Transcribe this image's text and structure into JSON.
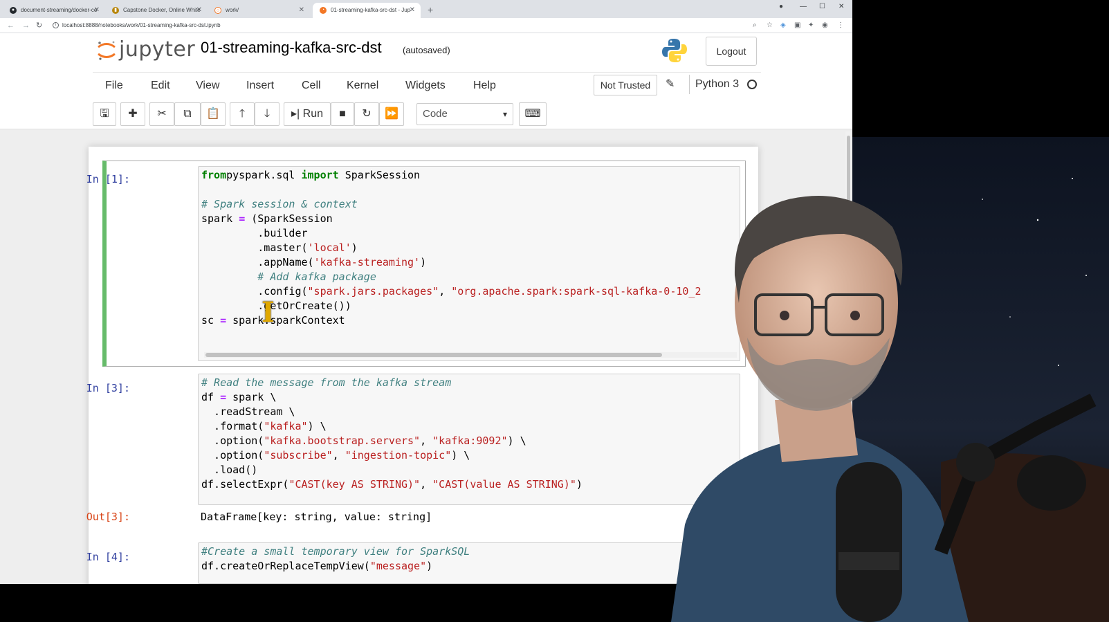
{
  "browser": {
    "tabs": [
      {
        "title": "document-streaming/docker-co",
        "active": false
      },
      {
        "title": "Capstone Docker, Online White",
        "active": false
      },
      {
        "title": "work/",
        "active": false
      },
      {
        "title": "01-streaming-kafka-src-dst - Jup",
        "active": true
      }
    ],
    "new_tab": "+",
    "url": "localhost:8888/notebooks/work/01-streaming-kafka-src-dst.ipynb"
  },
  "jupyter": {
    "brand": "jupyter",
    "notebook_title": "01-streaming-kafka-src-dst",
    "autosave_status": "(autosaved)",
    "logout_label": "Logout",
    "menu": [
      "File",
      "Edit",
      "View",
      "Insert",
      "Cell",
      "Kernel",
      "Widgets",
      "Help"
    ],
    "trust_status": "Not Trusted",
    "kernel": "Python 3",
    "toolbar": {
      "run_label": "Run",
      "cell_type": "Code"
    }
  },
  "cells": [
    {
      "prompt": "In [1]:",
      "lines": [
        [
          [
            "kw",
            "from"
          ],
          [
            "",
            "pyspark.sql "
          ],
          [
            "kw",
            "import"
          ],
          [
            "",
            " SparkSession"
          ]
        ],
        [],
        [
          [
            "cmt",
            "# Spark session & context"
          ]
        ],
        [
          [
            "",
            "spark "
          ],
          [
            "op",
            "="
          ],
          [
            "",
            " (SparkSession"
          ]
        ],
        [
          [
            "",
            "         .builder"
          ]
        ],
        [
          [
            "",
            "         .master("
          ],
          [
            "str",
            "'local'"
          ],
          [
            "",
            ")"
          ]
        ],
        [
          [
            "",
            "         .appName("
          ],
          [
            "str",
            "'kafka-streaming'"
          ],
          [
            "",
            ")"
          ]
        ],
        [
          [
            "cmt",
            "         # Add kafka package"
          ]
        ],
        [
          [
            "",
            "         .config("
          ],
          [
            "str",
            "\"spark.jars.packages\""
          ],
          [
            "",
            ", "
          ],
          [
            "str",
            "\"org.apache.spark:spark-sql-kafka-0-10_2"
          ]
        ],
        [
          [
            "",
            "         .getOrCreate())"
          ]
        ],
        [
          [
            "",
            "sc "
          ],
          [
            "op",
            "="
          ],
          [
            "",
            " spark.sparkContext"
          ]
        ]
      ]
    },
    {
      "prompt": "In [3]:",
      "lines": [
        [
          [
            "cmt",
            "# Read the message from the kafka stream"
          ]
        ],
        [
          [
            "",
            "df "
          ],
          [
            "op",
            "="
          ],
          [
            "",
            " spark \\"
          ]
        ],
        [
          [
            "",
            "  .readStream \\"
          ]
        ],
        [
          [
            "",
            "  .format("
          ],
          [
            "str",
            "\"kafka\""
          ],
          [
            "",
            ") \\"
          ]
        ],
        [
          [
            "",
            "  .option("
          ],
          [
            "str",
            "\"kafka.bootstrap.servers\""
          ],
          [
            "",
            ", "
          ],
          [
            "str",
            "\"kafka:9092\""
          ],
          [
            "",
            ") \\"
          ]
        ],
        [
          [
            "",
            "  .option("
          ],
          [
            "str",
            "\"subscribe\""
          ],
          [
            "",
            ", "
          ],
          [
            "str",
            "\"ingestion-topic\""
          ],
          [
            "",
            ") \\"
          ]
        ],
        [
          [
            "",
            "  .load()"
          ]
        ],
        [
          [
            "",
            "df.selectExpr("
          ],
          [
            "str",
            "\"CAST(key AS STRING)\""
          ],
          [
            "",
            ", "
          ],
          [
            "str",
            "\"CAST(value AS STRING)\""
          ],
          [
            "",
            ")"
          ]
        ]
      ],
      "out_prompt": "Out[3]:",
      "output": "DataFrame[key: string, value: string]"
    },
    {
      "prompt": "In [4]:",
      "lines": [
        [
          [
            "cmt",
            "#Create a small temporary view for SparkSQL"
          ]
        ],
        [
          [
            "",
            "df.createOrReplaceTempView("
          ],
          [
            "str",
            "\"message\""
          ],
          [
            "",
            ")"
          ]
        ]
      ]
    }
  ],
  "colors": {
    "selected_cell_border": "#66bb6a",
    "in_prompt": "#303f9f",
    "out_prompt": "#d84315",
    "keyword": "#008000",
    "string": "#ba2121",
    "comment": "#408080"
  }
}
